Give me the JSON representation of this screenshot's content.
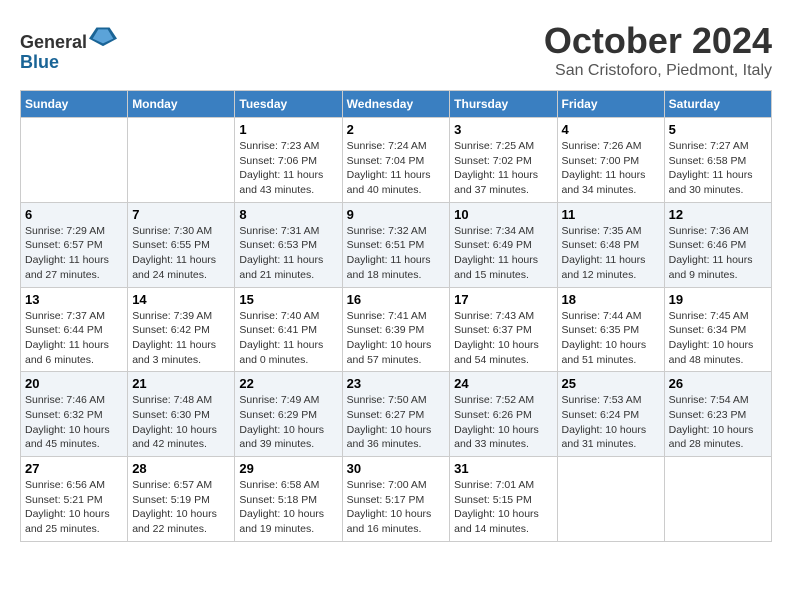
{
  "header": {
    "logo_line1": "General",
    "logo_line2": "Blue",
    "month": "October 2024",
    "location": "San Cristoforo, Piedmont, Italy"
  },
  "columns": [
    "Sunday",
    "Monday",
    "Tuesday",
    "Wednesday",
    "Thursday",
    "Friday",
    "Saturday"
  ],
  "weeks": [
    [
      {
        "day": "",
        "text": ""
      },
      {
        "day": "",
        "text": ""
      },
      {
        "day": "1",
        "text": "Sunrise: 7:23 AM\nSunset: 7:06 PM\nDaylight: 11 hours\nand 43 minutes."
      },
      {
        "day": "2",
        "text": "Sunrise: 7:24 AM\nSunset: 7:04 PM\nDaylight: 11 hours\nand 40 minutes."
      },
      {
        "day": "3",
        "text": "Sunrise: 7:25 AM\nSunset: 7:02 PM\nDaylight: 11 hours\nand 37 minutes."
      },
      {
        "day": "4",
        "text": "Sunrise: 7:26 AM\nSunset: 7:00 PM\nDaylight: 11 hours\nand 34 minutes."
      },
      {
        "day": "5",
        "text": "Sunrise: 7:27 AM\nSunset: 6:58 PM\nDaylight: 11 hours\nand 30 minutes."
      }
    ],
    [
      {
        "day": "6",
        "text": "Sunrise: 7:29 AM\nSunset: 6:57 PM\nDaylight: 11 hours\nand 27 minutes."
      },
      {
        "day": "7",
        "text": "Sunrise: 7:30 AM\nSunset: 6:55 PM\nDaylight: 11 hours\nand 24 minutes."
      },
      {
        "day": "8",
        "text": "Sunrise: 7:31 AM\nSunset: 6:53 PM\nDaylight: 11 hours\nand 21 minutes."
      },
      {
        "day": "9",
        "text": "Sunrise: 7:32 AM\nSunset: 6:51 PM\nDaylight: 11 hours\nand 18 minutes."
      },
      {
        "day": "10",
        "text": "Sunrise: 7:34 AM\nSunset: 6:49 PM\nDaylight: 11 hours\nand 15 minutes."
      },
      {
        "day": "11",
        "text": "Sunrise: 7:35 AM\nSunset: 6:48 PM\nDaylight: 11 hours\nand 12 minutes."
      },
      {
        "day": "12",
        "text": "Sunrise: 7:36 AM\nSunset: 6:46 PM\nDaylight: 11 hours\nand 9 minutes."
      }
    ],
    [
      {
        "day": "13",
        "text": "Sunrise: 7:37 AM\nSunset: 6:44 PM\nDaylight: 11 hours\nand 6 minutes."
      },
      {
        "day": "14",
        "text": "Sunrise: 7:39 AM\nSunset: 6:42 PM\nDaylight: 11 hours\nand 3 minutes."
      },
      {
        "day": "15",
        "text": "Sunrise: 7:40 AM\nSunset: 6:41 PM\nDaylight: 11 hours\nand 0 minutes."
      },
      {
        "day": "16",
        "text": "Sunrise: 7:41 AM\nSunset: 6:39 PM\nDaylight: 10 hours\nand 57 minutes."
      },
      {
        "day": "17",
        "text": "Sunrise: 7:43 AM\nSunset: 6:37 PM\nDaylight: 10 hours\nand 54 minutes."
      },
      {
        "day": "18",
        "text": "Sunrise: 7:44 AM\nSunset: 6:35 PM\nDaylight: 10 hours\nand 51 minutes."
      },
      {
        "day": "19",
        "text": "Sunrise: 7:45 AM\nSunset: 6:34 PM\nDaylight: 10 hours\nand 48 minutes."
      }
    ],
    [
      {
        "day": "20",
        "text": "Sunrise: 7:46 AM\nSunset: 6:32 PM\nDaylight: 10 hours\nand 45 minutes."
      },
      {
        "day": "21",
        "text": "Sunrise: 7:48 AM\nSunset: 6:30 PM\nDaylight: 10 hours\nand 42 minutes."
      },
      {
        "day": "22",
        "text": "Sunrise: 7:49 AM\nSunset: 6:29 PM\nDaylight: 10 hours\nand 39 minutes."
      },
      {
        "day": "23",
        "text": "Sunrise: 7:50 AM\nSunset: 6:27 PM\nDaylight: 10 hours\nand 36 minutes."
      },
      {
        "day": "24",
        "text": "Sunrise: 7:52 AM\nSunset: 6:26 PM\nDaylight: 10 hours\nand 33 minutes."
      },
      {
        "day": "25",
        "text": "Sunrise: 7:53 AM\nSunset: 6:24 PM\nDaylight: 10 hours\nand 31 minutes."
      },
      {
        "day": "26",
        "text": "Sunrise: 7:54 AM\nSunset: 6:23 PM\nDaylight: 10 hours\nand 28 minutes."
      }
    ],
    [
      {
        "day": "27",
        "text": "Sunrise: 6:56 AM\nSunset: 5:21 PM\nDaylight: 10 hours\nand 25 minutes."
      },
      {
        "day": "28",
        "text": "Sunrise: 6:57 AM\nSunset: 5:19 PM\nDaylight: 10 hours\nand 22 minutes."
      },
      {
        "day": "29",
        "text": "Sunrise: 6:58 AM\nSunset: 5:18 PM\nDaylight: 10 hours\nand 19 minutes."
      },
      {
        "day": "30",
        "text": "Sunrise: 7:00 AM\nSunset: 5:17 PM\nDaylight: 10 hours\nand 16 minutes."
      },
      {
        "day": "31",
        "text": "Sunrise: 7:01 AM\nSunset: 5:15 PM\nDaylight: 10 hours\nand 14 minutes."
      },
      {
        "day": "",
        "text": ""
      },
      {
        "day": "",
        "text": ""
      }
    ]
  ]
}
